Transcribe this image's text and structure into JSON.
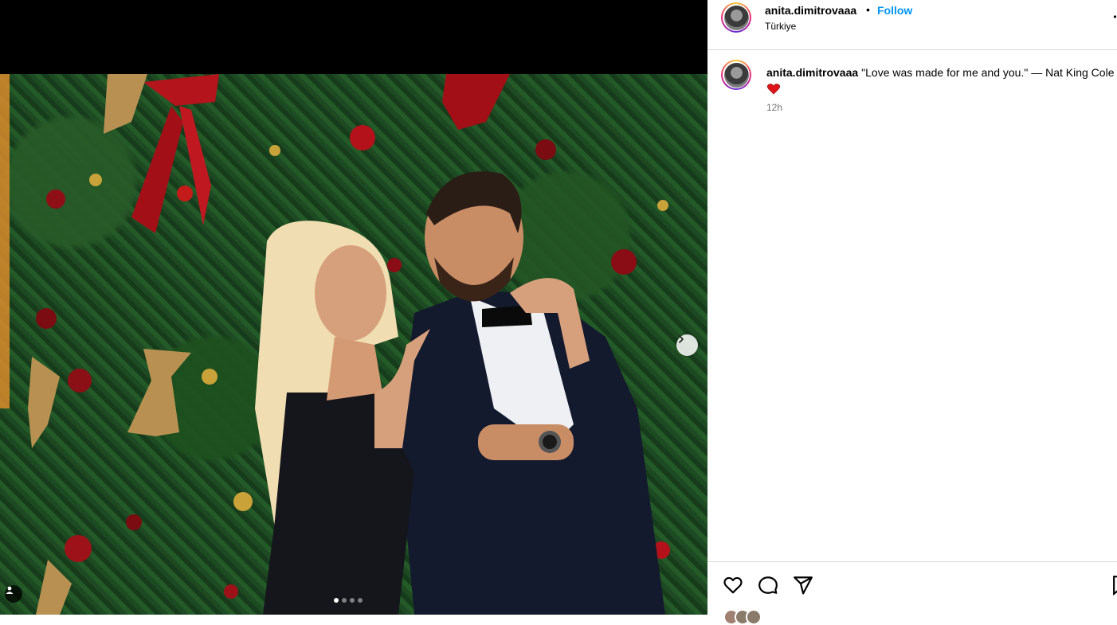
{
  "post": {
    "username": "anita.dimitrovaaa",
    "follow_label": "Follow",
    "separator": "•",
    "location": "Türkiye"
  },
  "caption": {
    "username": "anita.dimitrovaaa",
    "text": "\"Love was made for me and you.\" — Nat King Cole",
    "time": "12h"
  },
  "gallery": {
    "slides": 4,
    "active_slide": 1
  },
  "icons": {
    "like": "heart-icon",
    "comment": "comment-icon",
    "share": "send-icon",
    "save": "bookmark-icon",
    "next": "chevron-right-icon",
    "tag": "user-tag-icon",
    "more": "more-options-icon"
  },
  "colors": {
    "follow": "#0095f6",
    "muted": "#737373",
    "divider": "#dbdbdb"
  }
}
